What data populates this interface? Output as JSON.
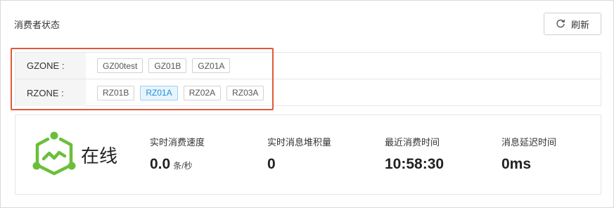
{
  "header": {
    "title": "消费者状态",
    "refresh_label": "刷新"
  },
  "zones": [
    {
      "label": "GZONE :",
      "tags": [
        {
          "text": "GZ00test",
          "selected": false
        },
        {
          "text": "GZ01B",
          "selected": false
        },
        {
          "text": "GZ01A",
          "selected": false
        }
      ]
    },
    {
      "label": "RZONE :",
      "tags": [
        {
          "text": "RZ01B",
          "selected": false
        },
        {
          "text": "RZ01A",
          "selected": true
        },
        {
          "text": "RZ02A",
          "selected": false
        },
        {
          "text": "RZ03A",
          "selected": false
        }
      ]
    }
  ],
  "status": {
    "text": "在线",
    "icon": "online-status-icon",
    "color": "#6abf3a"
  },
  "metrics": [
    {
      "label": "实时消费速度",
      "value": "0.0",
      "unit": "条/秒"
    },
    {
      "label": "实时消息堆积量",
      "value": "0",
      "unit": ""
    },
    {
      "label": "最近消费时间",
      "value": "10:58:30",
      "unit": ""
    },
    {
      "label": "消息延迟时间",
      "value": "0ms",
      "unit": ""
    }
  ],
  "colors": {
    "highlight_border": "#e0593b",
    "selected_tag_text": "#1e90d8",
    "selected_tag_bg": "#e8f4fd"
  }
}
